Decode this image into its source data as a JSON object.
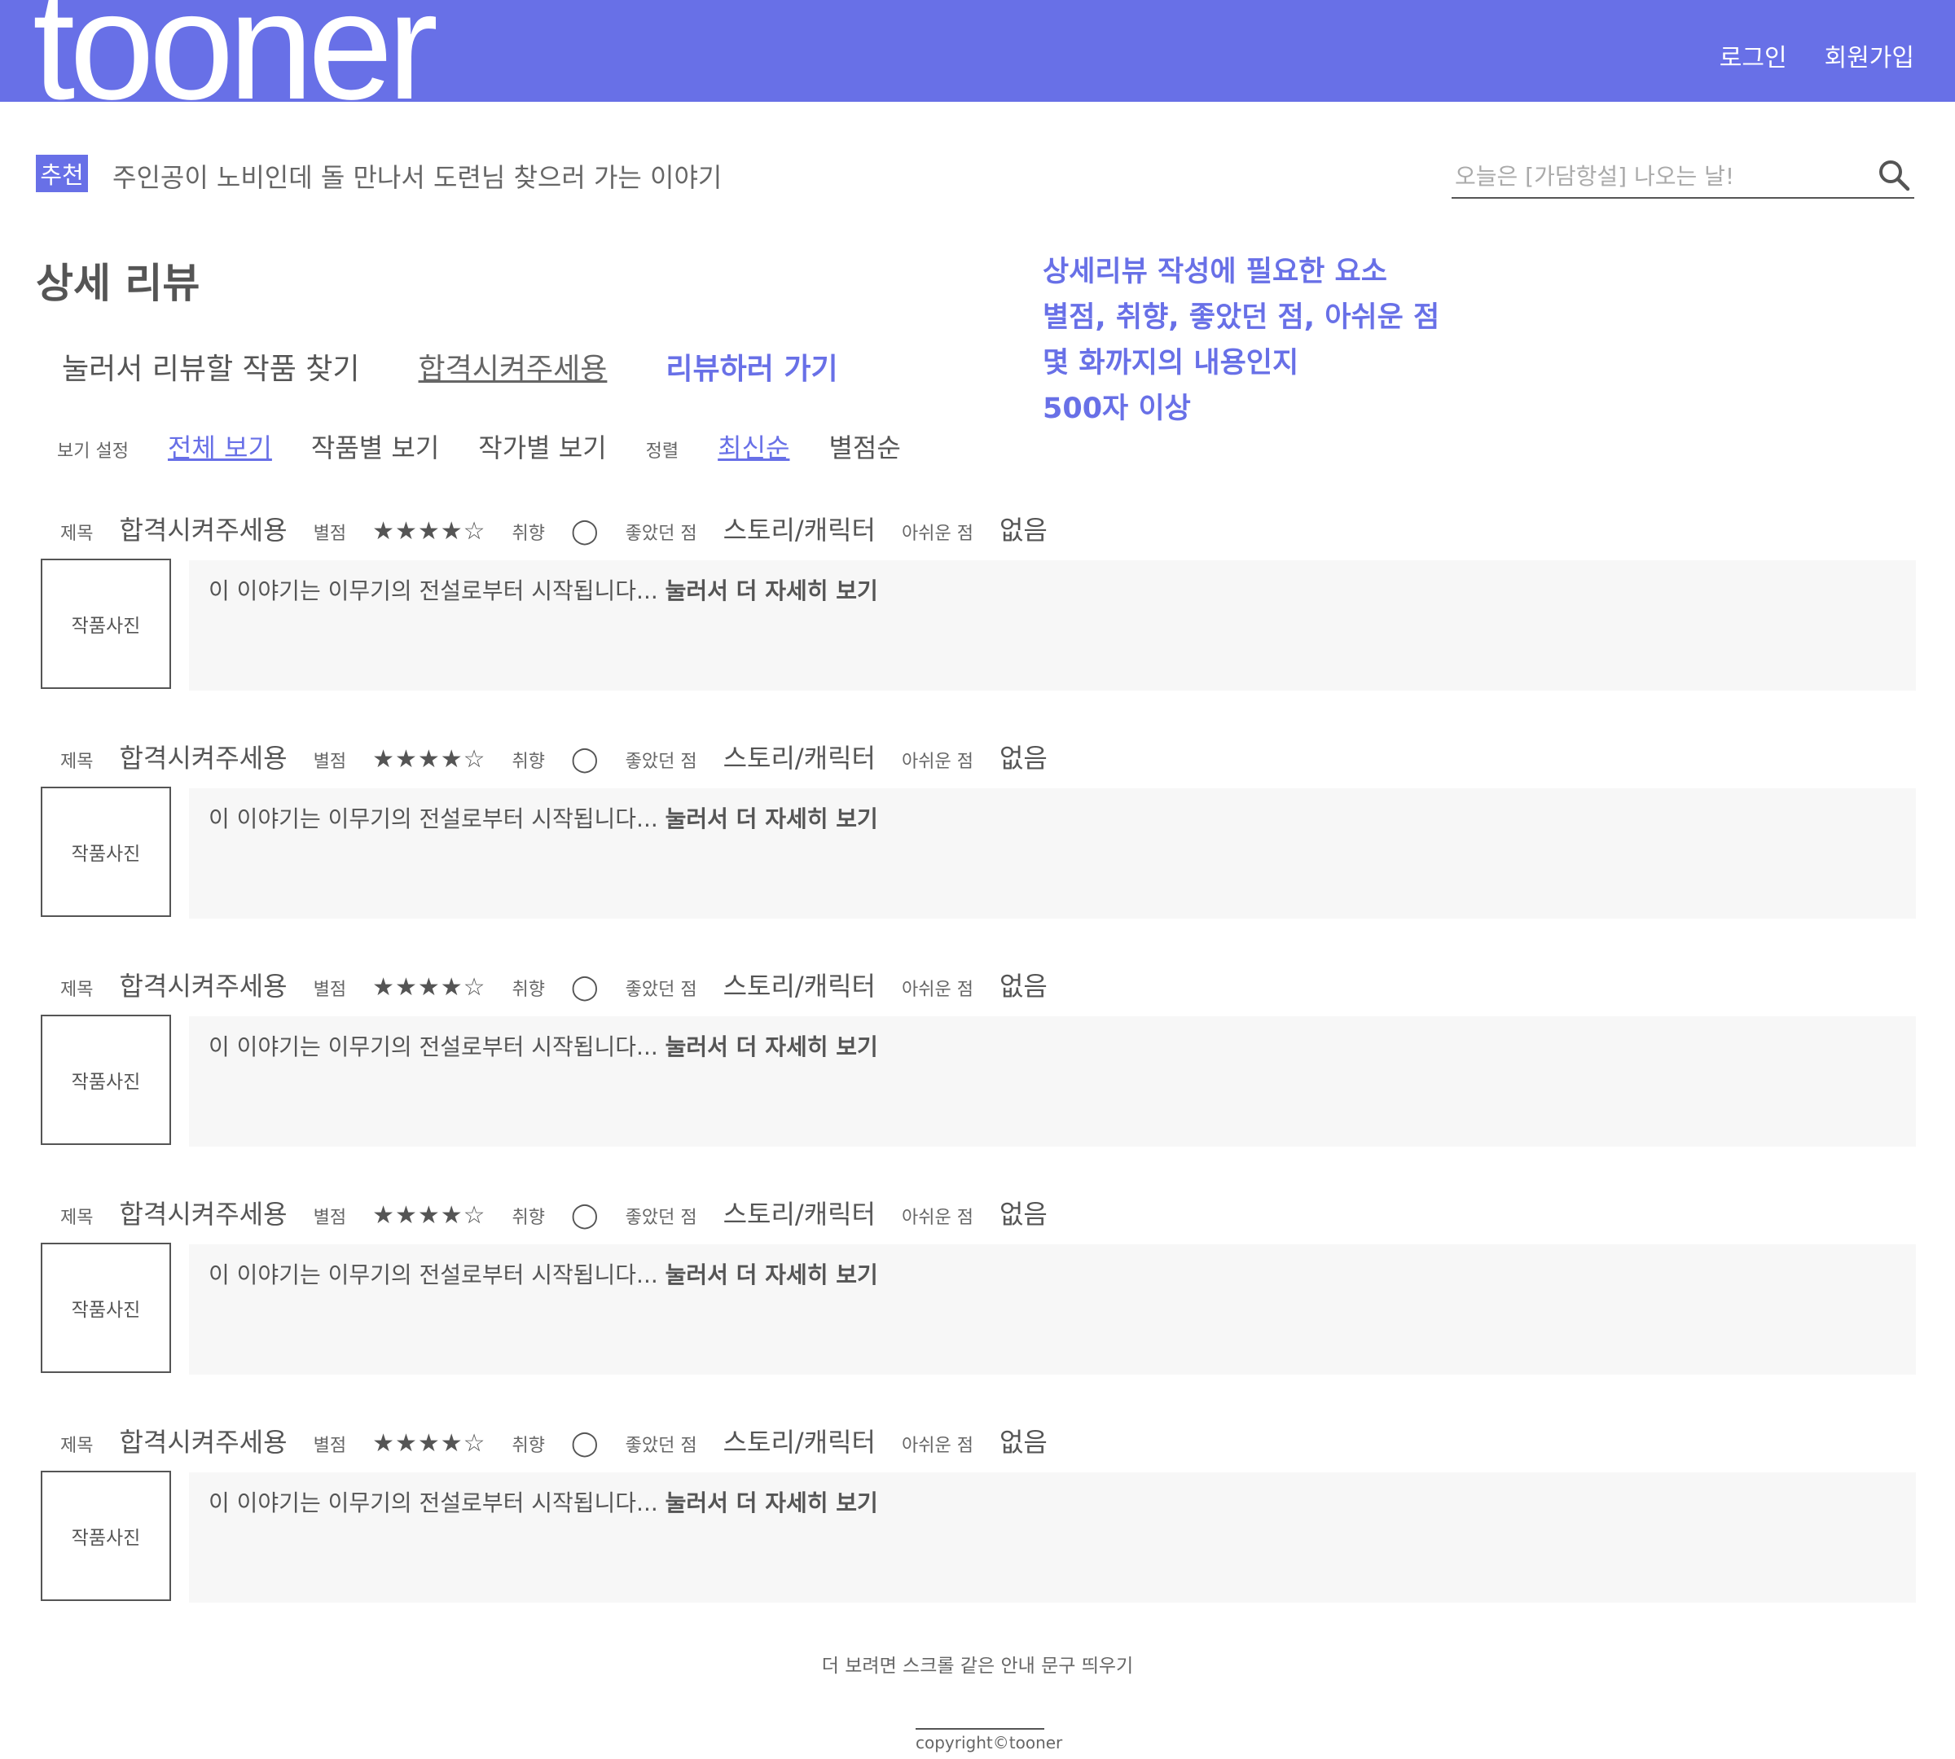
{
  "header": {
    "logo": "tooner",
    "login": "로그인",
    "signup": "회원가입"
  },
  "recommend": {
    "badge": "추천",
    "text": "주인공이 노비인데 돌 만나서 도련님 찾으러 가는 이야기"
  },
  "search": {
    "placeholder": "오늘은 [가담항설] 나오는 날!"
  },
  "page_title": "상세 리뷰",
  "actions": {
    "find": "눌러서 리뷰할 작품 찾기",
    "work": "합격시켜주세용",
    "go": "리뷰하러 가기"
  },
  "note_lines": [
    "상세리뷰 작성에 필요한 요소",
    "별점, 취향, 좋았던 점, 아쉬운 점",
    "몇 화까지의 내용인지",
    "500자 이상"
  ],
  "filters": {
    "view_label": "보기 설정",
    "view_options": [
      "전체 보기",
      "작품별 보기",
      "작가별 보기"
    ],
    "sort_label": "정렬",
    "sort_options": [
      "최신순",
      "별점순"
    ]
  },
  "review_labels": {
    "title": "제목",
    "rating": "별점",
    "taste": "취향",
    "liked": "좋았던 점",
    "disliked": "아쉬운 점",
    "photo": "작품사진"
  },
  "reviews": [
    {
      "title": "합격시켜주세용",
      "stars": "★★★★☆",
      "rating": 4,
      "taste": "◯",
      "liked": "스토리/캐릭터",
      "disliked": "없음",
      "excerpt": "이 이야기는 이무기의 전설로부터 시작됩니다...",
      "more": "눌러서 더 자세히 보기"
    },
    {
      "title": "합격시켜주세용",
      "stars": "★★★★☆",
      "rating": 4,
      "taste": "◯",
      "liked": "스토리/캐릭터",
      "disliked": "없음",
      "excerpt": "이 이야기는 이무기의 전설로부터 시작됩니다...",
      "more": "눌러서 더 자세히 보기"
    },
    {
      "title": "합격시켜주세용",
      "stars": "★★★★☆",
      "rating": 4,
      "taste": "◯",
      "liked": "스토리/캐릭터",
      "disliked": "없음",
      "excerpt": "이 이야기는 이무기의 전설로부터 시작됩니다...",
      "more": "눌러서 더 자세히 보기"
    },
    {
      "title": "합격시켜주세용",
      "stars": "★★★★☆",
      "rating": 4,
      "taste": "◯",
      "liked": "스토리/캐릭터",
      "disliked": "없음",
      "excerpt": "이 이야기는 이무기의 전설로부터 시작됩니다...",
      "more": "눌러서 더 자세히 보기"
    },
    {
      "title": "합격시켜주세용",
      "stars": "★★★★☆",
      "rating": 4,
      "taste": "◯",
      "liked": "스토리/캐릭터",
      "disliked": "없음",
      "excerpt": "이 이야기는 이무기의 전설로부터 시작됩니다...",
      "more": "눌러서 더 자세히 보기"
    }
  ],
  "footer": {
    "scroll_hint": "더 보려면 스크롤 같은 안내 문구 띄우기",
    "copyright": "copyright©tooner"
  },
  "colors": {
    "brand": "#6870e7",
    "text": "#555555",
    "excerpt_bg": "#f7f7f7"
  },
  "icons": {
    "search": "search-icon"
  }
}
